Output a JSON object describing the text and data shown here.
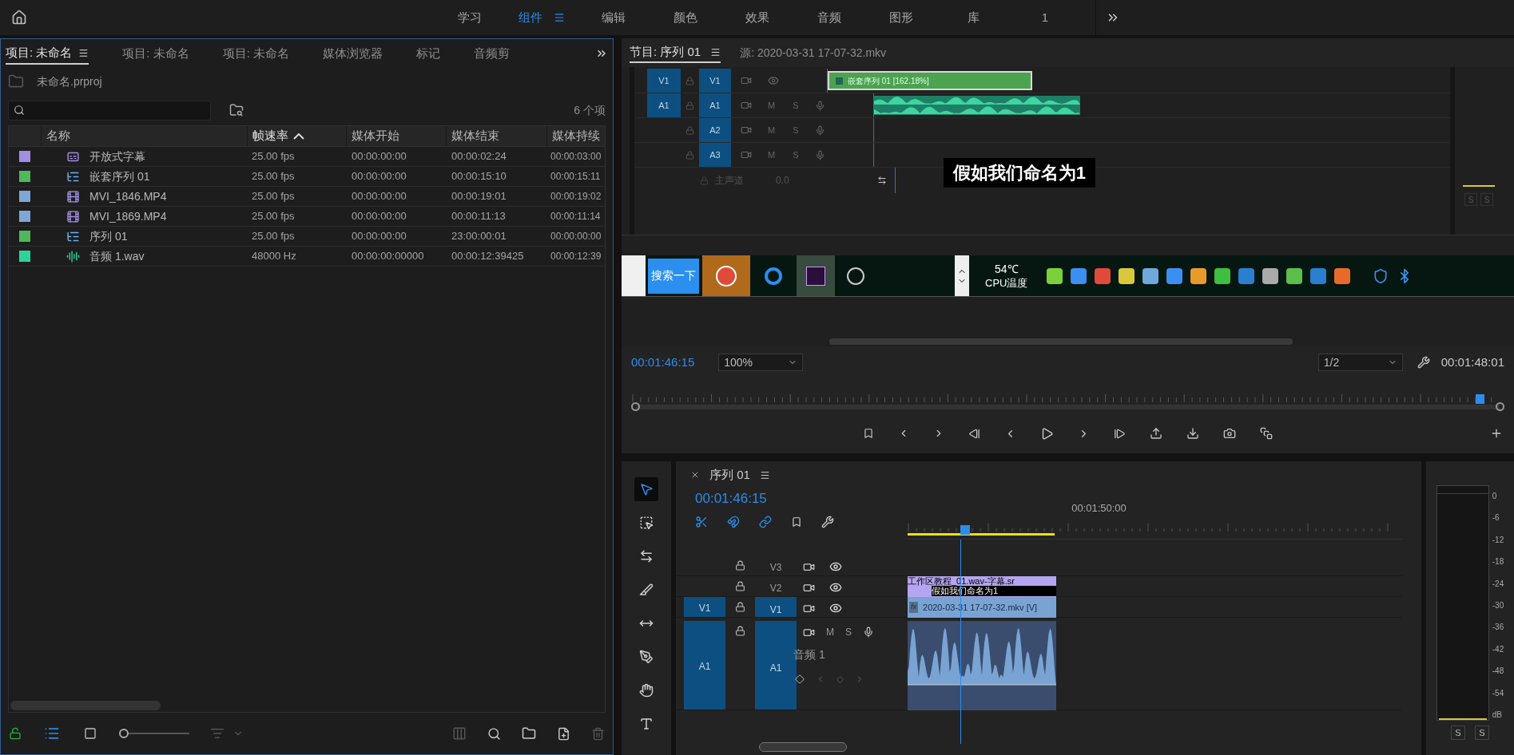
{
  "workspaces": {
    "tabs": [
      {
        "label": "学习",
        "selected": false
      },
      {
        "label": "组件",
        "selected": true
      },
      {
        "label": "编辑",
        "selected": false
      },
      {
        "label": "颜色",
        "selected": false
      },
      {
        "label": "效果",
        "selected": false
      },
      {
        "label": "音频",
        "selected": false
      },
      {
        "label": "图形",
        "selected": false
      },
      {
        "label": "库",
        "selected": false
      },
      {
        "label": "1",
        "selected": false
      }
    ]
  },
  "project": {
    "tabs": [
      {
        "label": "项目: 未命名",
        "selected": true
      },
      {
        "label": "项目: 未命名",
        "selected": false
      },
      {
        "label": "项目: 未命名",
        "selected": false
      },
      {
        "label": "媒体浏览器",
        "selected": false
      },
      {
        "label": "标记",
        "selected": false
      },
      {
        "label": "音频剪",
        "selected": false
      }
    ],
    "path": "未命名.prproj",
    "item_count": "6 个项",
    "columns": [
      {
        "label": "名称",
        "sorted": false
      },
      {
        "label": "帧速率",
        "sorted": true
      },
      {
        "label": "媒体开始",
        "sorted": false
      },
      {
        "label": "媒体结束",
        "sorted": false
      },
      {
        "label": "媒体持续",
        "sorted": false
      }
    ],
    "rows": [
      {
        "color": "#a28fe0",
        "kind": "caption",
        "name": "开放式字幕",
        "frame_rate": "25.00 fps",
        "start": "00:00:00:00",
        "end": "00:00:02:24",
        "duration": "00:00:03:00"
      },
      {
        "color": "#4fb85a",
        "kind": "sequence",
        "name": "嵌套序列 01",
        "frame_rate": "25.00 fps",
        "start": "00:00:00:00",
        "end": "00:00:15:10",
        "duration": "00:00:15:11"
      },
      {
        "color": "#7ea7d8",
        "kind": "video",
        "name": "MVI_1846.MP4",
        "frame_rate": "25.00 fps",
        "start": "00:00:00:00",
        "end": "00:00:19:01",
        "duration": "00:00:19:02"
      },
      {
        "color": "#7ea7d8",
        "kind": "video",
        "name": "MVI_1869.MP4",
        "frame_rate": "25.00 fps",
        "start": "00:00:00:00",
        "end": "00:00:11:13",
        "duration": "00:00:11:14"
      },
      {
        "color": "#4fb85a",
        "kind": "sequence",
        "name": "序列 01",
        "frame_rate": "25.00 fps",
        "start": "00:00:00:00",
        "end": "23:00:00:01",
        "duration": "00:00:00:00"
      },
      {
        "color": "#2fd39a",
        "kind": "audio",
        "name": "音频 1.wav",
        "frame_rate": "48000 Hz",
        "start": "00:00:00:00000",
        "end": "00:00:12:39425",
        "duration": "00:00:12:39"
      }
    ],
    "views": [
      {
        "kind": "list",
        "selected": true
      },
      {
        "kind": "icon",
        "selected": false
      }
    ],
    "zoom": {
      "level": 0
    }
  },
  "program": {
    "tabs": [
      {
        "label": "节目: 序列 01",
        "selected": true
      },
      {
        "label": "源: 2020-03-31 17-07-32.mkv",
        "selected": false
      }
    ],
    "screen": {
      "tracks": [
        {
          "kind": "video",
          "source": "V1",
          "label": "V1"
        },
        {
          "kind": "audio",
          "source": "A1",
          "label": "A1",
          "m": "M",
          "s": "S"
        },
        {
          "kind": "audio",
          "label": "A2",
          "m": "M",
          "s": "S"
        },
        {
          "kind": "audio",
          "label": "A3",
          "m": "M",
          "s": "S"
        }
      ],
      "master": {
        "label": "主声道",
        "value": "0.0"
      },
      "clip": "嵌套序列 01 [162.18%]",
      "caption": "假如我们命名为1",
      "meter_buttons": [
        "S",
        "S"
      ],
      "taskbar": {
        "search_button": "搜索一下",
        "temperature": "54℃",
        "temperature_label": "CPU温度"
      }
    },
    "timecode": "00:01:46:15",
    "zoom": "100%",
    "resolution": "1/2",
    "duration": "00:01:48:01",
    "playhead": {
      "level": 0.99
    }
  },
  "timeline": {
    "title": "序列 01",
    "timecode": "00:01:46:15",
    "ruler_label": "00:01:50:00",
    "tools": [
      {
        "kind": "select",
        "selected": true
      },
      {
        "kind": "track-select",
        "selected": false
      },
      {
        "kind": "ripple",
        "selected": false
      },
      {
        "kind": "razor",
        "selected": false
      },
      {
        "kind": "slip",
        "selected": false
      },
      {
        "kind": "pen",
        "selected": false
      },
      {
        "kind": "hand",
        "selected": false
      },
      {
        "kind": "type",
        "selected": false
      }
    ],
    "tracks": [
      {
        "kind": "video",
        "label": "V3"
      },
      {
        "kind": "video",
        "label": "V2"
      },
      {
        "kind": "video",
        "source": "V1",
        "label": "V1"
      },
      {
        "kind": "audio",
        "source": "A1",
        "label": "A1",
        "m": "M",
        "s": "S",
        "name": "音频 1"
      }
    ],
    "clips": {
      "fx_badge": "fx",
      "caption_title": "工作区教程_01.wav-字幕.sr",
      "caption_text": "假如我们命名为1",
      "video": "2020-03-31 17-07-32.mkv [V]"
    },
    "meter": {
      "scale": [
        "0",
        "-6",
        "-12",
        "-18",
        "-24",
        "-30",
        "-36",
        "-42",
        "-48",
        "-54",
        "dB"
      ],
      "buttons": [
        "S",
        "S"
      ]
    }
  }
}
